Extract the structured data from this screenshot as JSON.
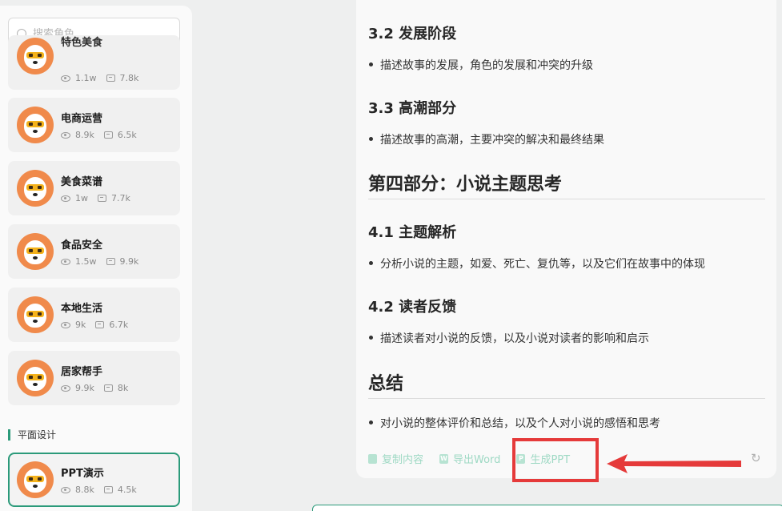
{
  "search": {
    "placeholder": "搜索角色"
  },
  "sidebar": {
    "cards": [
      {
        "title": "特色美食",
        "views": "1.1w",
        "comments": "7.8k"
      },
      {
        "title": "电商运营",
        "views": "8.9k",
        "comments": "6.5k"
      },
      {
        "title": "美食菜谱",
        "views": "1w",
        "comments": "7.7k"
      },
      {
        "title": "食品安全",
        "views": "1.5w",
        "comments": "9.9k"
      },
      {
        "title": "本地生活",
        "views": "9k",
        "comments": "6.7k"
      },
      {
        "title": "居家帮手",
        "views": "9.9k",
        "comments": "8k"
      }
    ],
    "section_label": "平面设计",
    "active_card": {
      "title": "PPT演示",
      "views": "8.8k",
      "comments": "4.5k"
    }
  },
  "content": {
    "s32_heading": "3.2 发展阶段",
    "s32_item": "描述故事的发展，角色的发展和冲突的升级",
    "s33_heading": "3.3 高潮部分",
    "s33_item": "描述故事的高潮，主要冲突的解决和最终结果",
    "part4_heading": "第四部分：小说主题思考",
    "s41_heading": "4.1 主题解析",
    "s41_item": "分析小说的主题，如爱、死亡、复仇等，以及它们在故事中的体现",
    "s42_heading": "4.2 读者反馈",
    "s42_item": "描述读者对小说的反馈，以及小说对读者的影响和启示",
    "summary_heading": "总结",
    "summary_item": "对小说的整体评价和总结，以及个人对小说的感悟和思考"
  },
  "actions": {
    "copy_label": "复制内容",
    "word_label": "导出Word",
    "word_icon": "W",
    "ppt_label": "生成PPT",
    "ppt_icon": "P"
  },
  "colors": {
    "accent": "#2b9a7a",
    "highlight": "#e53a3a",
    "action_text": "#9ed9c4"
  }
}
